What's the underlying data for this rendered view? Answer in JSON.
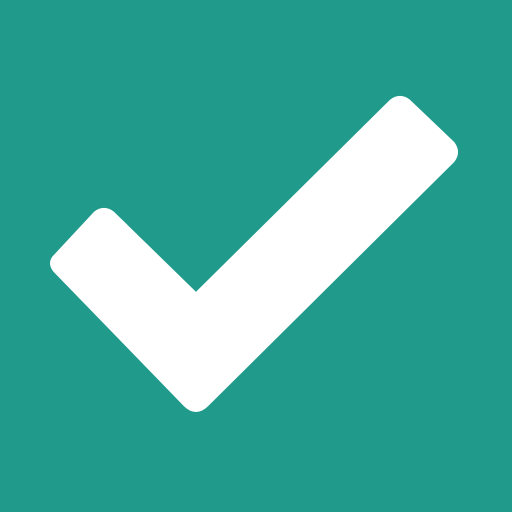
{
  "icon": {
    "name": "checkmark-icon",
    "background_color": "#1f9a8b",
    "foreground_color": "#ffffff"
  }
}
